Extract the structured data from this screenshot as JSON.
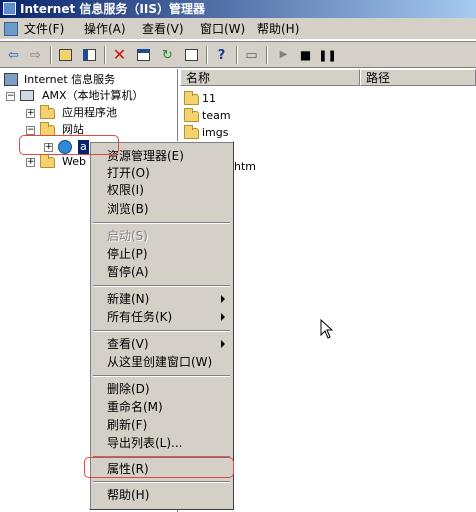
{
  "window": {
    "title": "Internet 信息服务（IIS）管理器"
  },
  "menubar": {
    "items": [
      {
        "id": "file",
        "label": "文件(F)"
      },
      {
        "id": "action",
        "label": "操作(A)"
      },
      {
        "id": "view",
        "label": "查看(V)"
      },
      {
        "id": "window",
        "label": "窗口(W)"
      },
      {
        "id": "help",
        "label": "帮助(H)"
      }
    ]
  },
  "toolbar": {
    "icons": [
      "back-icon",
      "forward-icon",
      "up-folder-icon",
      "show-tree-icon",
      "delete-icon",
      "properties-icon",
      "refresh-icon",
      "export-icon",
      "help-icon",
      "computer-icon",
      "start-icon",
      "stop-icon",
      "pause-icon"
    ]
  },
  "tree": {
    "root": "Internet 信息服务",
    "computer": "AMX（本地计算机）",
    "app_pools": "应用程序池",
    "websites": "网站",
    "site_selected": "a",
    "web_ext": "Web"
  },
  "list": {
    "columns": [
      "名称",
      "路径"
    ],
    "rows": [
      "11",
      "team",
      "imgs",
      "htm"
    ]
  },
  "context_menu": {
    "items": [
      {
        "label": "资源管理器(E)",
        "disabled": false
      },
      {
        "label": "打开(O)",
        "disabled": false
      },
      {
        "label": "权限(I)",
        "disabled": false
      },
      {
        "label": "浏览(B)",
        "disabled": false
      },
      {
        "label": "启动(S)",
        "disabled": true
      },
      {
        "label": "停止(P)",
        "disabled": false
      },
      {
        "label": "暂停(A)",
        "disabled": false
      },
      {
        "label": "新建(N)",
        "disabled": false,
        "submenu": true
      },
      {
        "label": "所有任务(K)",
        "disabled": false,
        "submenu": true
      },
      {
        "label": "查看(V)",
        "disabled": false,
        "submenu": true
      },
      {
        "label": "从这里创建窗口(W)",
        "disabled": false
      },
      {
        "label": "删除(D)",
        "disabled": false
      },
      {
        "label": "重命名(M)",
        "disabled": false
      },
      {
        "label": "刷新(F)",
        "disabled": false
      },
      {
        "label": "导出列表(L)...",
        "disabled": false
      },
      {
        "label": "属性(R)",
        "disabled": false
      },
      {
        "label": "帮助(H)",
        "disabled": false
      }
    ]
  },
  "colors": {
    "highlight_annotation": "#e04848",
    "titlebar_start": "#0a246a",
    "titlebar_end": "#a6caf0",
    "chrome": "#d4d0c8"
  }
}
